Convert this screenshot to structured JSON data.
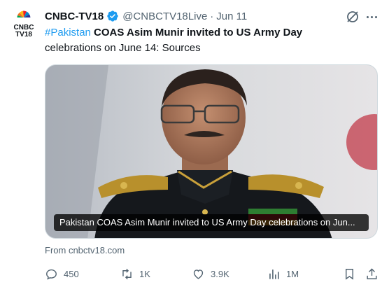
{
  "tweet": {
    "author_name": "CNBC-TV18",
    "author_handle": "@CNBCTV18Live",
    "separator": "·",
    "date": "Jun 11",
    "avatar_text_top": "CNBC",
    "avatar_text_bottom": "TV18",
    "text_hashtag": "#Pakistan",
    "text_bold": "COAS Asim Munir invited to US Army Day",
    "text_rest": "celebrations on June 14: Sources",
    "media_caption": "Pakistan COAS Asim Munir invited to US Army Day celebrations on Jun...",
    "source": "From cnbctv18.com"
  },
  "actions": {
    "replies": "450",
    "reposts": "1K",
    "likes": "3.9K",
    "views": "1M"
  },
  "colors": {
    "accent": "#1d9bf0",
    "muted": "#536471",
    "text": "#0f1419"
  }
}
